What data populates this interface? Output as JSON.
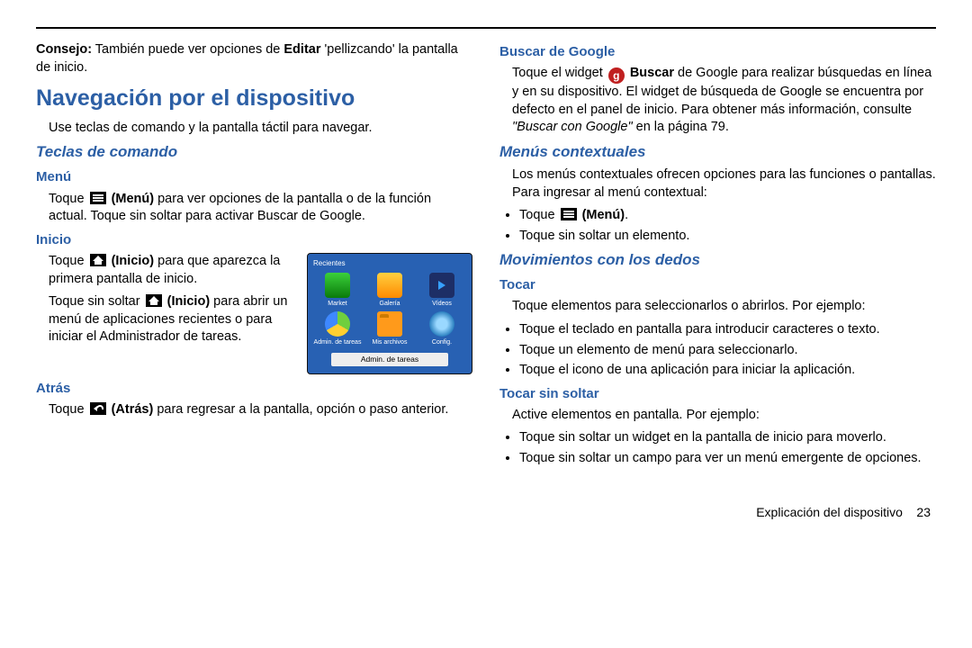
{
  "tip_strong": "Consejo:",
  "tip_text": " También puede ver opciones de ",
  "tip_editar": "Editar",
  "tip_rest": " 'pellizcando' la pantalla de inicio.",
  "h_nav": "Navegación por el dispositivo",
  "nav_intro": "Use teclas de comando y la pantalla táctil para navegar.",
  "h_teclas": "Teclas de comando",
  "h_menu": "Menú",
  "menu_txt_a": "Toque ",
  "menu_bold": " (Menú)",
  "menu_txt_b": " para ver opciones de la pantalla o de la función actual. Toque sin soltar para activar Buscar de Google.",
  "h_inicio": "Inicio",
  "inicio_a": "Toque ",
  "inicio_bold": " (Inicio)",
  "inicio_b": " para que aparezca la primera pantalla de inicio.",
  "inicio_c": "Toque sin soltar ",
  "inicio_bold2": " (Inicio)",
  "inicio_d": " para abrir un menú de aplicaciones recientes o para iniciar el Administrador de tareas.",
  "h_atras": "Atrás",
  "atras_a": "Toque ",
  "atras_bold": " (Atrás)",
  "atras_b": " para regresar a la pantalla, opción o paso anterior.",
  "recent_title": "Recientes",
  "apps": [
    "Market",
    "Galería",
    "Vídeos",
    "Admin. de tareas",
    "Mis archivos",
    "Config."
  ],
  "rp_btn": "Admin. de tareas",
  "h_buscar": "Buscar de Google",
  "buscar_a": "Toque el widget ",
  "buscar_bold": " Buscar",
  "buscar_b": " de Google para realizar búsquedas en línea y en su dispositivo. El widget de búsqueda de Google se encuentra por defecto en el panel de inicio. Para obtener más información, consulte ",
  "buscar_it": "\"Buscar con Google\"",
  "buscar_c": " en la página 79.",
  "h_contextual": "Menús contextuales",
  "ctx_txt": "Los menús contextuales ofrecen opciones para las funciones o pantallas. Para ingresar al menú contextual:",
  "ctx_li1_a": "Toque ",
  "ctx_li1_bold": " (Menú)",
  "ctx_li1_b": ".",
  "ctx_li2": "Toque sin soltar un elemento.",
  "h_mov": "Movimientos con los dedos",
  "h_tocar": "Tocar",
  "tocar_txt": "Toque elementos para seleccionarlos o abrirlos. Por ejemplo:",
  "t_li1": "Toque el teclado en pantalla para introducir caracteres o texto.",
  "t_li2": "Toque un elemento de menú para seleccionarlo.",
  "t_li3": "Toque el icono de una aplicación para iniciar la aplicación.",
  "h_tocarss": "Tocar sin soltar",
  "tss_txt": "Active elementos en pantalla. Por ejemplo:",
  "tss_li1": "Toque sin soltar un widget en la pantalla de inicio para moverlo.",
  "tss_li2": "Toque sin soltar un campo para ver un menú emergente de opciones.",
  "footer_label": "Explicación del dispositivo",
  "footer_page": "23"
}
